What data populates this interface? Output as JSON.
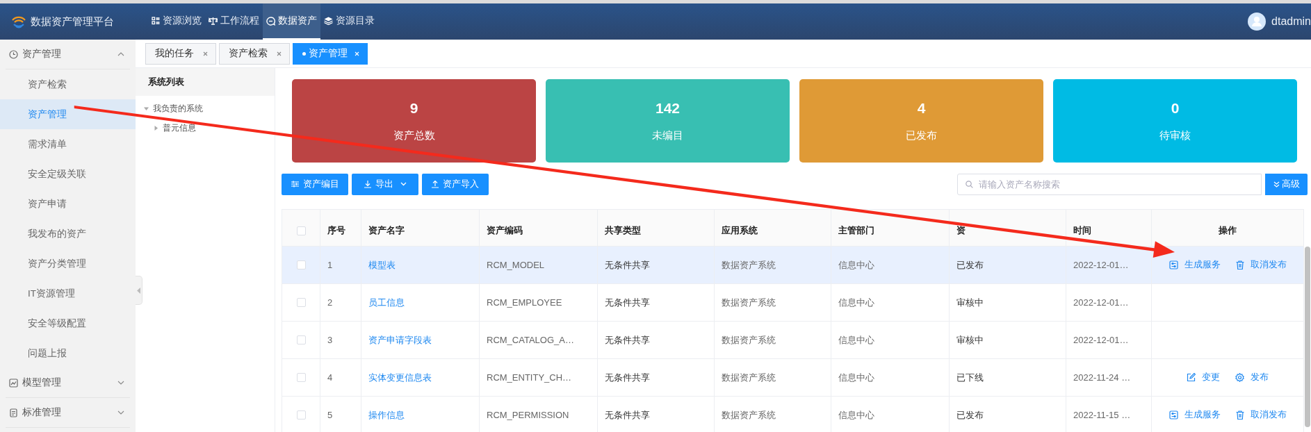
{
  "header": {
    "title": "数据资产管理平台",
    "nav": [
      {
        "label": "资源浏览",
        "selected": false
      },
      {
        "label": "工作流程",
        "selected": false
      },
      {
        "label": "数据资产",
        "selected": true
      },
      {
        "label": "资源目录",
        "selected": false
      }
    ],
    "user": "dtadmin"
  },
  "sidebar": {
    "groups": [
      {
        "label": "资产管理",
        "expanded": true,
        "children": [
          {
            "label": "资产检索",
            "selected": false
          },
          {
            "label": "资产管理",
            "selected": true
          },
          {
            "label": "需求清单",
            "selected": false
          },
          {
            "label": "安全定级关联",
            "selected": false
          },
          {
            "label": "资产申请",
            "selected": false
          },
          {
            "label": "我发布的资产",
            "selected": false
          },
          {
            "label": "资产分类管理",
            "selected": false
          },
          {
            "label": "IT资源管理",
            "selected": false
          },
          {
            "label": "安全等级配置",
            "selected": false
          },
          {
            "label": "问题上报",
            "selected": false
          }
        ]
      },
      {
        "label": "模型管理",
        "expanded": false
      },
      {
        "label": "标准管理",
        "expanded": false
      }
    ]
  },
  "tabs": [
    {
      "label": "我的任务",
      "selected": false
    },
    {
      "label": "资产检索",
      "selected": false
    },
    {
      "label": "资产管理",
      "selected": true
    }
  ],
  "tree": {
    "title": "系统列表",
    "items": [
      {
        "label": "我负责的系统",
        "expanded": true,
        "children": [
          {
            "label": "普元信息",
            "expanded": false
          }
        ]
      }
    ]
  },
  "stats": [
    {
      "value": "9",
      "label": "资产总数",
      "color": "#bb4444"
    },
    {
      "value": "142",
      "label": "未编目",
      "color": "#38bfb2"
    },
    {
      "value": "4",
      "label": "已发布",
      "color": "#df9a36"
    },
    {
      "value": "0",
      "label": "待审核",
      "color": "#00bbe4"
    }
  ],
  "toolbar": {
    "buttons": [
      {
        "label": "资产编目",
        "kind": "plain"
      },
      {
        "label": "导出",
        "kind": "dropdown"
      },
      {
        "label": "资产导入",
        "kind": "plain"
      }
    ],
    "search": {
      "placeholder": "请输入资产名称搜索"
    },
    "advanced": "高级"
  },
  "table": {
    "header_checked": false,
    "columns": [
      "序号",
      "资产名字",
      "资产编码",
      "共享类型",
      "应用系统",
      "主管部门",
      "资",
      "时间",
      "操作"
    ],
    "rows": [
      {
        "checked": false,
        "selected": true,
        "cells": [
          "1",
          "模型表",
          "RCM_MODEL",
          "无条件共享",
          "数据资产系统",
          "信息中心",
          "已发布",
          "2022-12-01…"
        ],
        "actions": [
          {
            "label": "生成服务",
            "kind": "service"
          },
          {
            "label": "取消发布",
            "kind": "unpublish"
          }
        ]
      },
      {
        "checked": false,
        "selected": false,
        "cells": [
          "2",
          "员工信息",
          "RCM_EMPLOYEE",
          "无条件共享",
          "数据资产系统",
          "信息中心",
          "审核中",
          "2022-12-01…"
        ],
        "actions": []
      },
      {
        "checked": false,
        "selected": false,
        "cells": [
          "3",
          "资产申请字段表",
          "RCM_CATALOG_A…",
          "无条件共享",
          "数据资产系统",
          "信息中心",
          "审核中",
          "2022-12-01…"
        ],
        "actions": []
      },
      {
        "checked": false,
        "selected": false,
        "cells": [
          "4",
          "实体变更信息表",
          "RCM_ENTITY_CH…",
          "无条件共享",
          "数据资产系统",
          "信息中心",
          "已下线",
          "2022-11-24 …"
        ],
        "actions": [
          {
            "label": "变更",
            "kind": "edit"
          },
          {
            "label": "发布",
            "kind": "publish"
          }
        ]
      },
      {
        "checked": false,
        "selected": false,
        "cells": [
          "5",
          "操作信息",
          "RCM_PERMISSION",
          "无条件共享",
          "数据资产系统",
          "信息中心",
          "已发布",
          "2022-11-15 …"
        ],
        "actions": [
          {
            "label": "生成服务",
            "kind": "service"
          },
          {
            "label": "取消发布",
            "kind": "unpublish"
          }
        ]
      }
    ]
  }
}
